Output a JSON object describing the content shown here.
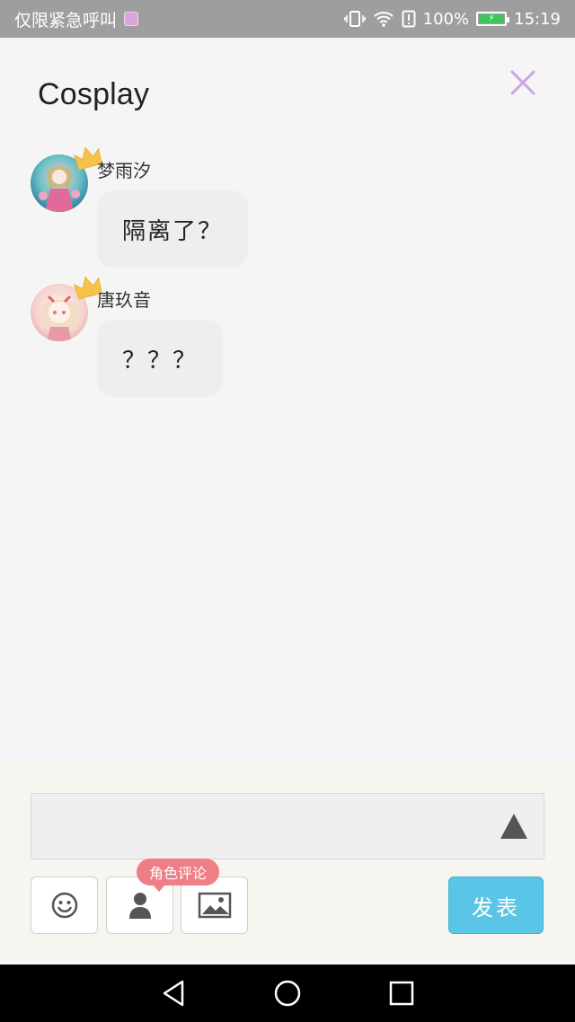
{
  "status_bar": {
    "carrier_text": "仅限紧急呼叫",
    "battery_percent": "100%",
    "time": "15:19",
    "icons": [
      "vibrate-icon",
      "wifi-icon",
      "alert-icon",
      "battery-icon"
    ]
  },
  "header": {
    "title": "Cosplay",
    "close_icon": "close-icon",
    "accent_color": "#c9a6e5"
  },
  "messages": [
    {
      "username": "梦雨汐",
      "text": "隔离了？",
      "avatar": "avatar-icon",
      "badge": "crown-icon"
    },
    {
      "username": "唐玖音",
      "text": "？？？",
      "avatar": "avatar-icon",
      "badge": "crown-icon"
    }
  ],
  "composer": {
    "input_value": "",
    "expand_icon": "triangle-up-icon",
    "tools": [
      {
        "name": "emoji-button",
        "icon": "smiley-icon"
      },
      {
        "name": "role-button",
        "icon": "person-icon"
      },
      {
        "name": "image-button",
        "icon": "image-icon"
      }
    ],
    "tooltip_label": "角色评论",
    "publish_label": "发表",
    "publish_color": "#5bc5e7",
    "tooltip_color": "#ef7f86"
  },
  "nav_bar": {
    "buttons": [
      "back-icon",
      "home-icon",
      "recents-icon"
    ]
  }
}
